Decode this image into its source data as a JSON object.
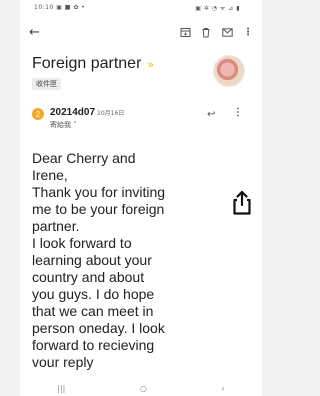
{
  "status": {
    "left": "10:10 ▣ ■ ✿ •",
    "right": "▣ ✲ ◔ ᯤ ⊿ ▮"
  },
  "email": {
    "subject": "Foreign partner",
    "importance_marker": "»",
    "label": "收件匣",
    "sender_initial": "2",
    "sender": "20214d07",
    "time": "10月16日",
    "to": "寄給我 ˅",
    "body": "Dear Cherry and\nIrene,\nThank you for inviting\nme to be your foreign\npartner.\nI look forward to\nlearning about your\ncountry and about\nyou guys. I do hope\nthat we can meet in\nperson oneday. I look\nforward to recieving\nvour reply"
  },
  "nav": {
    "recent": "|||",
    "home": "○",
    "back": "‹"
  },
  "colors": {
    "accent": "#f5a623",
    "importance": "#f4b400"
  },
  "icons": [
    "back-arrow-icon",
    "archive-icon",
    "delete-icon",
    "mail-icon",
    "more-vert-icon",
    "reply-icon",
    "share-icon"
  ]
}
